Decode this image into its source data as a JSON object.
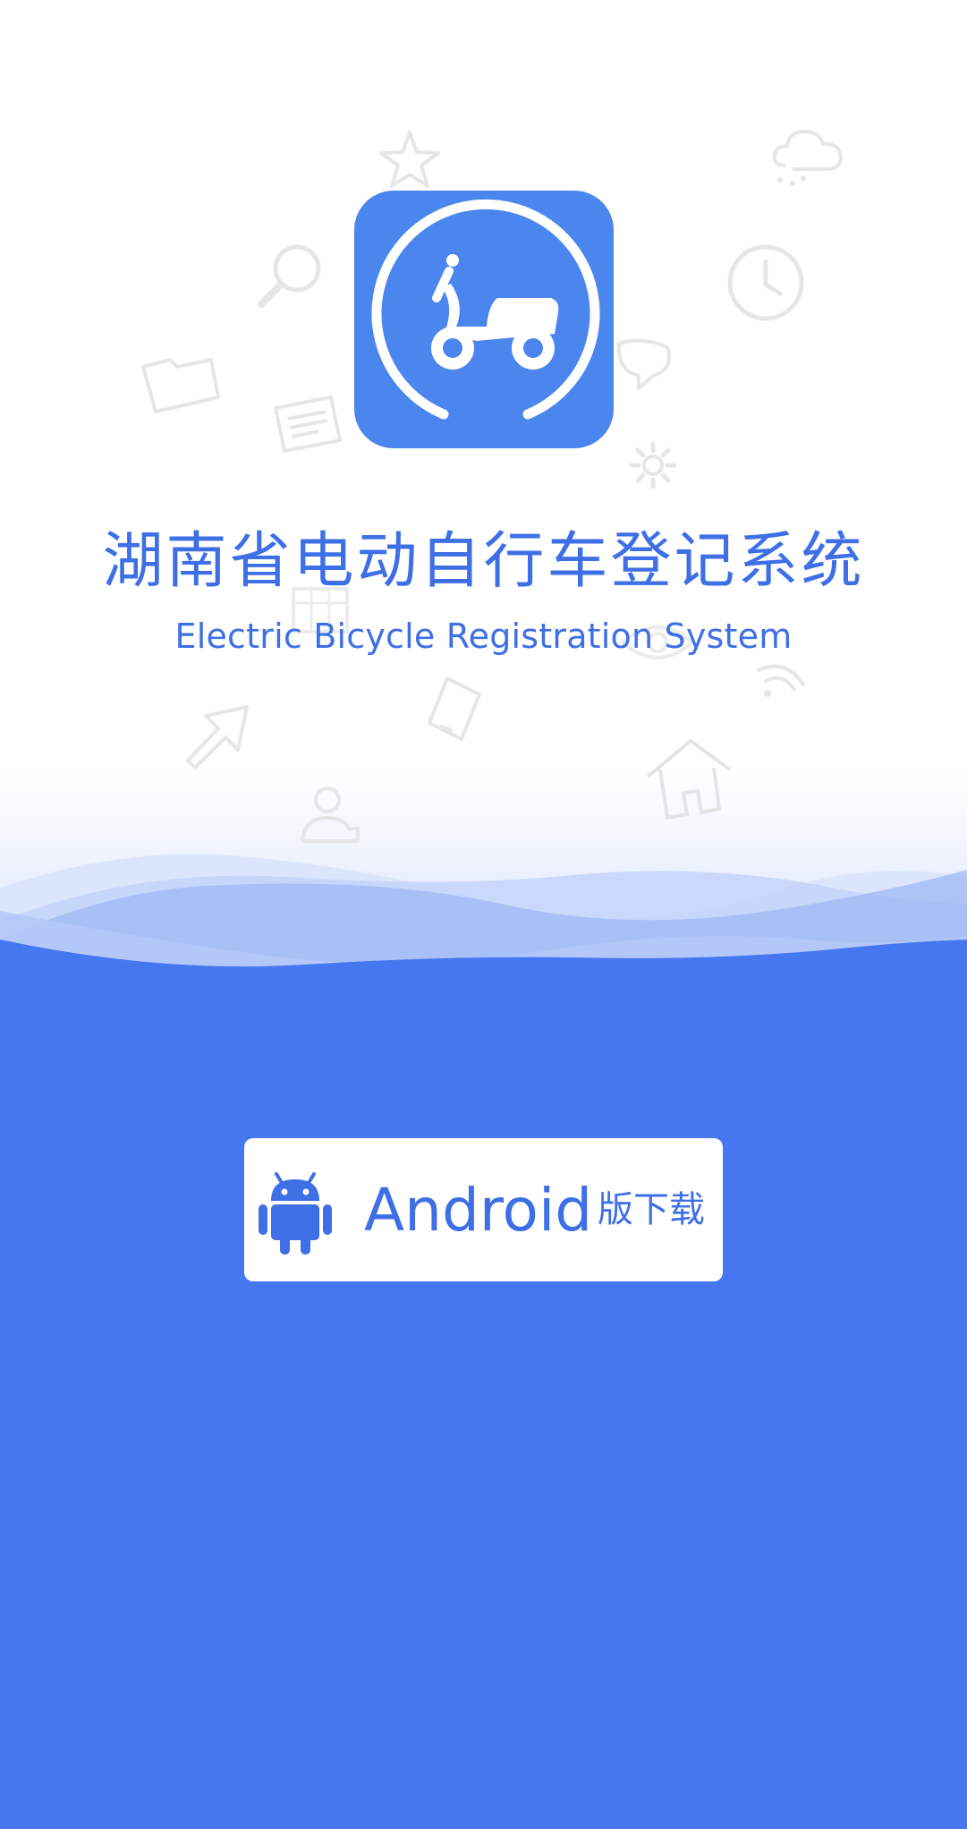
{
  "app": {
    "title": "湖南省电动自行车登记系统",
    "subtitle": "Electric Bicycle Registration System",
    "icon": "scooter-icon"
  },
  "download": {
    "platform_label": "Android",
    "suffix_label": "版下载",
    "icon": "android-icon"
  },
  "colors": {
    "primary": "#4577f0",
    "accent": "#3e6fe6",
    "icon_bg": "#4a86ee",
    "background_top": "#ffffff"
  },
  "decorative_icons": [
    "star-icon",
    "cloud-icon",
    "search-icon",
    "clock-icon",
    "folder-icon",
    "document-icon",
    "chat-icon",
    "gear-icon",
    "calendar-icon",
    "eye-icon",
    "wifi-icon",
    "phone-icon",
    "cursor-icon",
    "home-icon",
    "user-icon"
  ]
}
